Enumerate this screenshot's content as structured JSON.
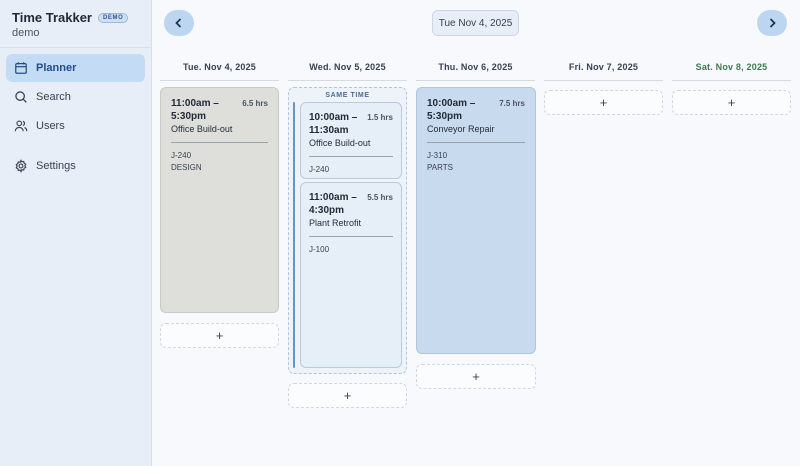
{
  "app": {
    "title": "Time Trakker",
    "badge": "DEMO",
    "user": "demo"
  },
  "nav": {
    "planner": "Planner",
    "search": "Search",
    "users": "Users",
    "settings": "Settings"
  },
  "toolbar": {
    "current_date": "Tue Nov 4, 2025"
  },
  "days": {
    "d0": "Tue. Nov 4, 2025",
    "d1": "Wed. Nov 5, 2025",
    "d2": "Thu. Nov 6, 2025",
    "d3": "Fri. Nov 7, 2025",
    "d4": "Sat. Nov 8, 2025"
  },
  "same_time_label": "SAME TIME",
  "add_label": "+",
  "jobs": {
    "tue": {
      "time": "11:00am – 5:30pm",
      "hours": "6.5 hrs",
      "name": "Office Build-out",
      "code": "J-240",
      "tag": "DESIGN",
      "color": "#dedfda"
    },
    "wed_a": {
      "time": "10:00am – 11:30am",
      "hours": "1.5 hrs",
      "name": "Office Build-out",
      "code": "J-240"
    },
    "wed_b": {
      "time": "11:00am – 4:30pm",
      "hours": "5.5 hrs",
      "name": "Plant Retrofit",
      "code": "J-100"
    },
    "thu": {
      "time": "10:00am – 5:30pm",
      "hours": "7.5 hrs",
      "name": "Conveyor Repair",
      "code": "J-310",
      "tag": "PARTS",
      "color": "#c8dbee"
    }
  },
  "colors": {
    "accent": "#c4dbf5",
    "sidebar": "#e8eef7",
    "saturday": "#3f7a4e"
  }
}
